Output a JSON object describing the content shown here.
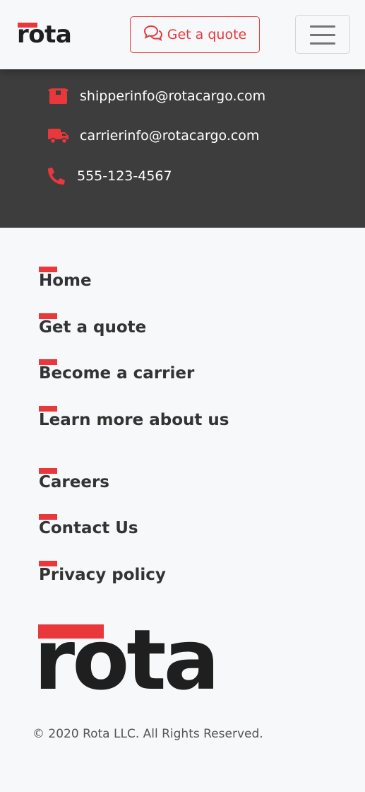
{
  "brand": {
    "logo_text": "rota",
    "accent_color": "#e8383c",
    "dark_color": "#3d3d3d"
  },
  "navbar": {
    "quote_button": {
      "label": "Get a quote",
      "icon": "comments-icon"
    },
    "menu_toggle": {
      "icon": "hamburger-menu-icon"
    }
  },
  "contact": {
    "items": [
      {
        "icon": "box-icon",
        "text": "shipperinfo@rotacargo.com"
      },
      {
        "icon": "truck-icon",
        "text": "carrierinfo@rotacargo.com"
      },
      {
        "icon": "phone-icon",
        "text": "555-123-4567"
      }
    ]
  },
  "footer": {
    "links": [
      {
        "label": "Home"
      },
      {
        "label": "Get a quote"
      },
      {
        "label": "Become a carrier"
      },
      {
        "label": "Learn more about us"
      },
      {
        "label": "Careers"
      },
      {
        "label": "Contact Us"
      },
      {
        "label": "Privacy policy"
      }
    ],
    "copyright": "© 2020 Rota LLC. All Rights Reserved."
  }
}
